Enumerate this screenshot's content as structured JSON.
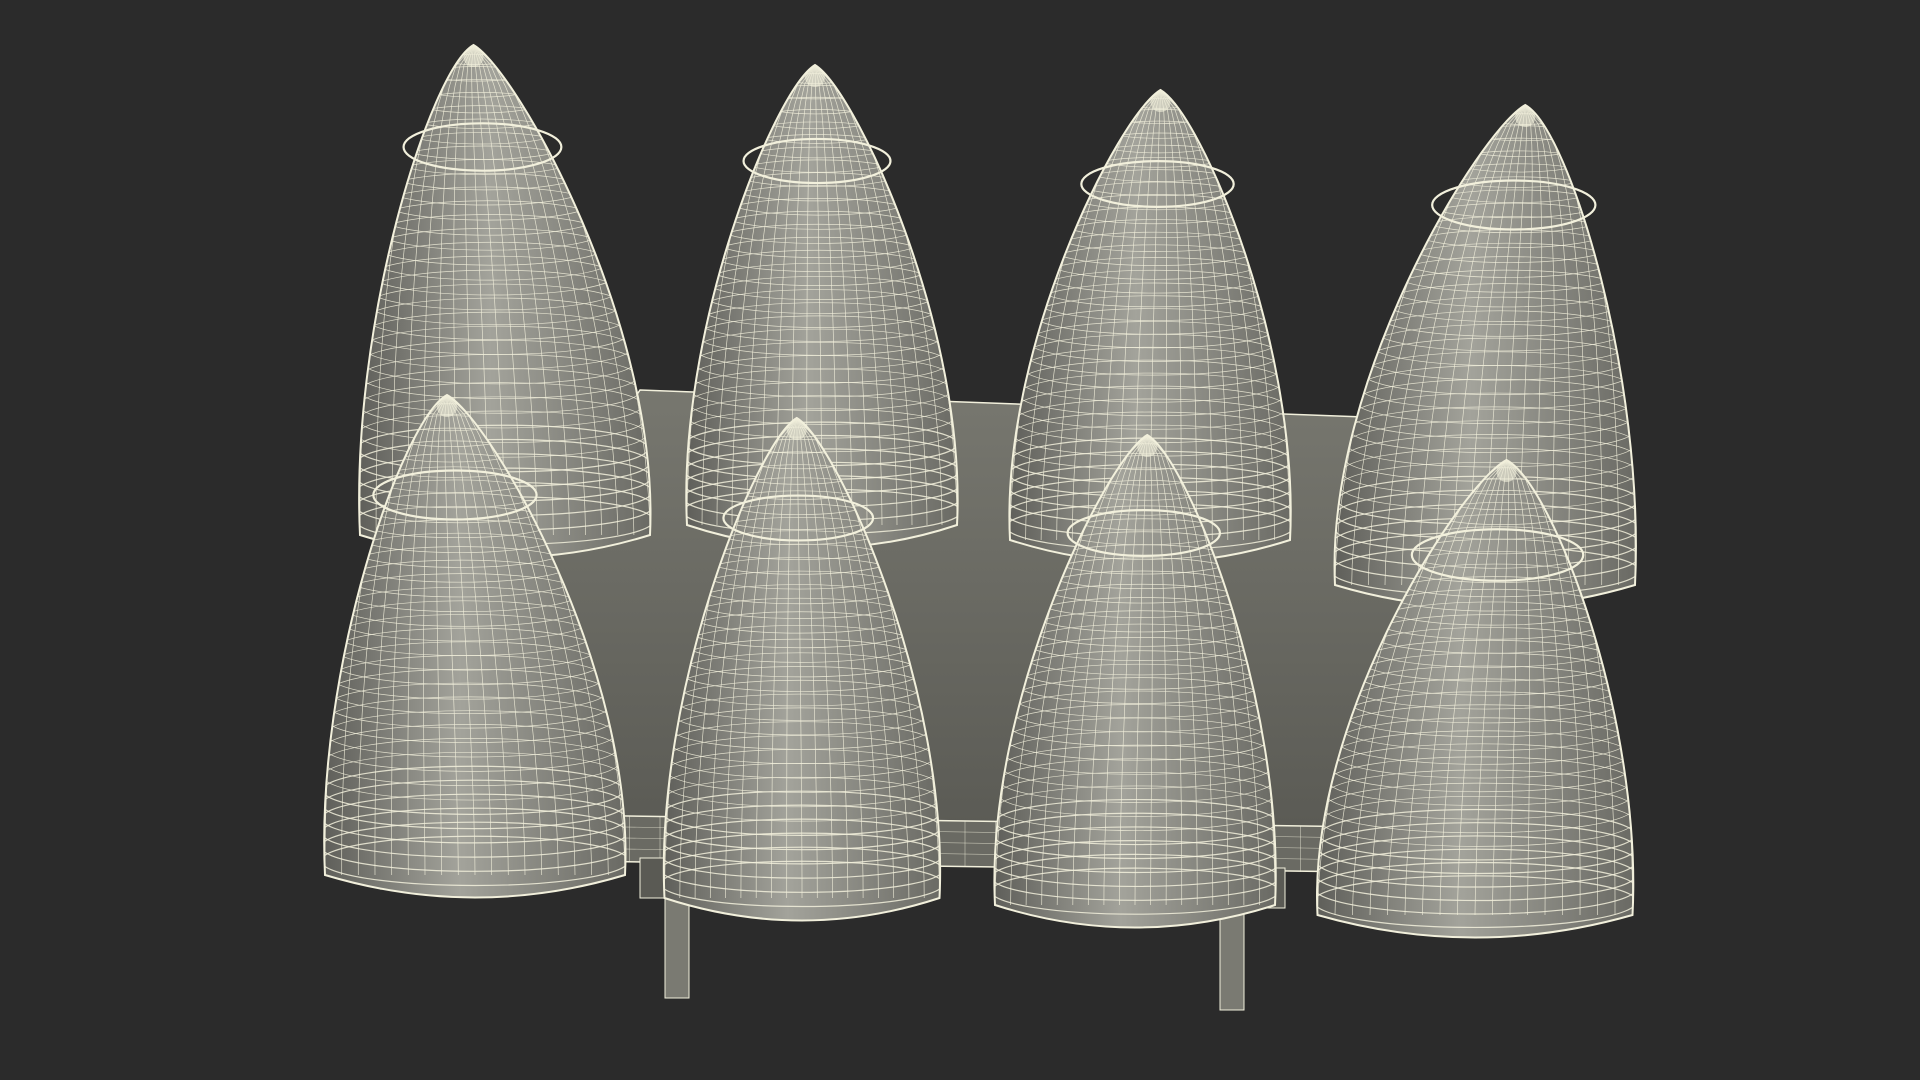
{
  "scene": {
    "subject": "wireframe-render",
    "background_color": "#2b2b2b",
    "surface_color": "#8f8f88",
    "surface_shadow_color": "#5c5c57",
    "wire_color": "#f2f0dc",
    "projectile_count": 8,
    "rows": 2,
    "columns": 4
  }
}
